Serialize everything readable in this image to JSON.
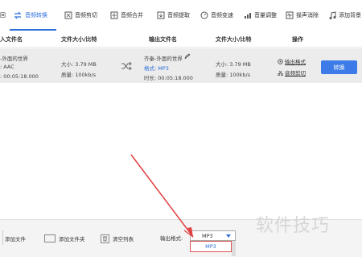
{
  "toolbar": {
    "items": [
      {
        "label": "回",
        "icon": "home-icon"
      },
      {
        "label": "音频转换",
        "icon": "convert-icon",
        "active": true
      },
      {
        "label": "音频剪切",
        "icon": "cut-icon"
      },
      {
        "label": "音频合并",
        "icon": "merge-icon"
      },
      {
        "label": "音频提取",
        "icon": "extract-icon"
      },
      {
        "label": "音频变速",
        "icon": "speed-icon"
      },
      {
        "label": "音量调整",
        "icon": "volume-icon"
      },
      {
        "label": "操声消除",
        "icon": "noise-icon"
      },
      {
        "label": "添加背景",
        "icon": "music-icon"
      }
    ],
    "accent": "#2d6fdc"
  },
  "table": {
    "headers": {
      "input_name": "入文件名",
      "input_size": "文件大小/比特",
      "output_name": "输出文件名",
      "output_size": "文件大小/比特",
      "actions": "操作"
    },
    "row": {
      "input_title": "-外面的世界",
      "input_format": ": AAC",
      "input_duration": ": 00:05:18.000",
      "input_size": "大小: 3.79 MB",
      "input_quality": "质量: 100kb/s",
      "output_title": "齐秦-外面的世界",
      "output_format_label": "格式:",
      "output_format_value": "MP3",
      "output_duration": "时长: 00:05:18.000",
      "output_size": "大小: 3.79 MB",
      "output_quality": "质量: 100kb/s",
      "link_output_format": "输出格式",
      "link_audio_cut": "音频剪切",
      "convert_button": "转换"
    }
  },
  "bottom": {
    "add_file": "添加文件",
    "add_folder": "添加文件夹",
    "clear_list": "清空列表",
    "output_format_label": "输出格式:",
    "output_format_value": "MP3",
    "dropdown_option": "MP3"
  },
  "watermark": "软件技巧"
}
